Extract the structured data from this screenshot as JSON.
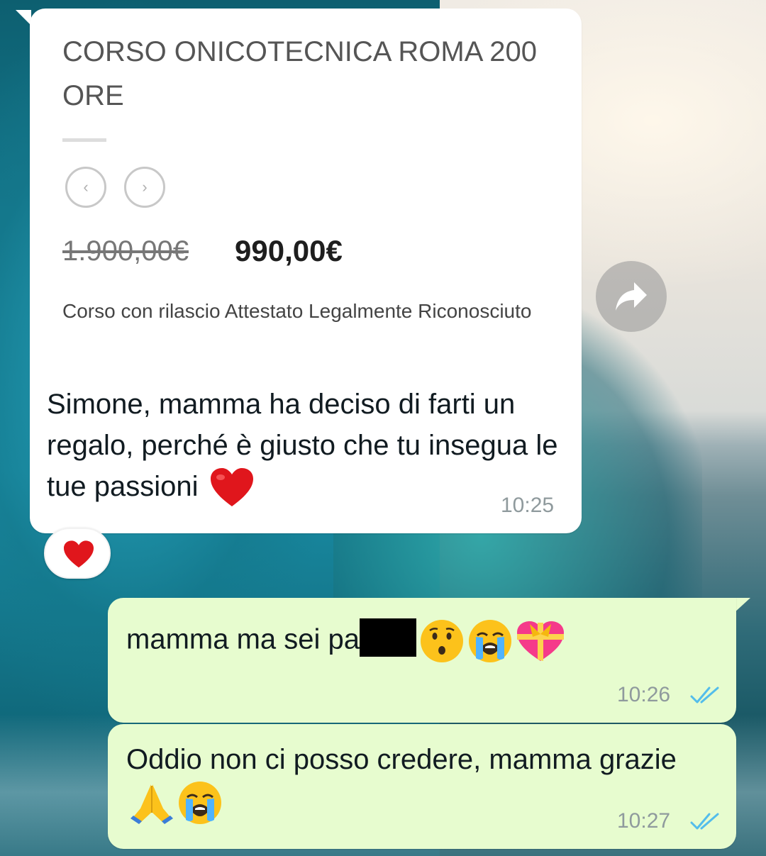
{
  "incoming_message": {
    "link_preview": {
      "title": "CORSO ONICOTECNICA ROMA 200 ORE",
      "prev_arrow": "‹",
      "next_arrow": "›",
      "old_price": "1.900,00€",
      "new_price": "990,00€",
      "description": "Corso con rilascio Attestato Legalmente Riconosciuto"
    },
    "text": "Simone, mamma ha deciso di farti un regalo, perché è giusto che tu insegua le tue passioni",
    "emoji": "red-heart",
    "time": "10:25",
    "reaction": "red-heart"
  },
  "outgoing_messages": [
    {
      "text_before_redaction": "mamma ma sei pa",
      "emojis": [
        "hushed-face",
        "loudly-crying-face",
        "heart-with-ribbon"
      ],
      "time": "10:26",
      "status": "read"
    },
    {
      "text": "Oddio non ci posso credere, mamma grazie",
      "emojis": [
        "folded-hands",
        "loudly-crying-face"
      ],
      "time": "10:27",
      "status": "read"
    }
  ],
  "colors": {
    "incoming_bubble": "#ffffff",
    "outgoing_bubble": "#e7fccf",
    "read_ticks": "#53bdeb",
    "timestamp": "#8f9a9d"
  }
}
